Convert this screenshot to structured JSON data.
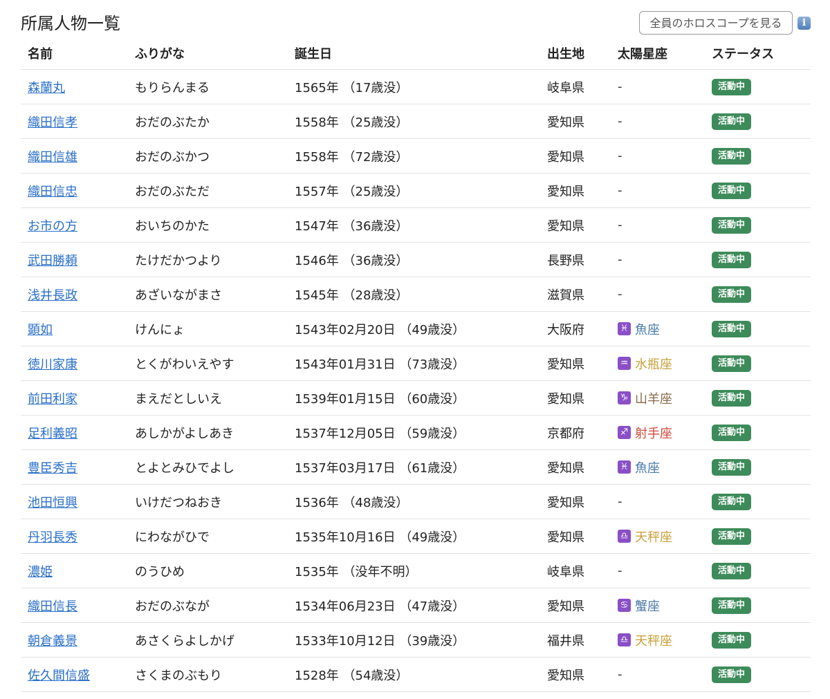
{
  "page": {
    "title": "所属人物一覧",
    "horoscope_button": "全員のホロスコープを見る",
    "info_icon": "i"
  },
  "table": {
    "headers": [
      "名前",
      "ふりがな",
      "誕生日",
      "出生地",
      "太陽星座",
      "ステータス"
    ],
    "rows": [
      {
        "name": "森蘭丸",
        "furigana": "もりらんまる",
        "birth": "1565年 （17歳没）",
        "place": "岐阜県",
        "zodiac": {
          "text": "-"
        },
        "status": "活動中"
      },
      {
        "name": "織田信孝",
        "furigana": "おだのぶたか",
        "birth": "1558年 （25歳没）",
        "place": "愛知県",
        "zodiac": {
          "text": "-"
        },
        "status": "活動中"
      },
      {
        "name": "織田信雄",
        "furigana": "おだのぶかつ",
        "birth": "1558年 （72歳没）",
        "place": "愛知県",
        "zodiac": {
          "text": "-"
        },
        "status": "活動中"
      },
      {
        "name": "織田信忠",
        "furigana": "おだのぶただ",
        "birth": "1557年 （25歳没）",
        "place": "愛知県",
        "zodiac": {
          "text": "-"
        },
        "status": "活動中"
      },
      {
        "name": "お市の方",
        "furigana": "おいちのかた",
        "birth": "1547年 （36歳没）",
        "place": "愛知県",
        "zodiac": {
          "text": "-"
        },
        "status": "活動中"
      },
      {
        "name": "武田勝頼",
        "furigana": "たけだかつより",
        "birth": "1546年 （36歳没）",
        "place": "長野県",
        "zodiac": {
          "text": "-"
        },
        "status": "活動中"
      },
      {
        "name": "浅井長政",
        "furigana": "あざいながまさ",
        "birth": "1545年 （28歳没）",
        "place": "滋賀県",
        "zodiac": {
          "text": "-"
        },
        "status": "活動中"
      },
      {
        "name": "顕如",
        "furigana": "けんにょ",
        "birth": "1543年02月20日 （49歳没）",
        "place": "大阪府",
        "zodiac": {
          "text": "魚座",
          "symbol": "♓",
          "icon": "pisces-icon",
          "color": "#4a7aa8"
        },
        "status": "活動中"
      },
      {
        "name": "徳川家康",
        "furigana": "とくがわいえやす",
        "birth": "1543年01月31日 （73歳没）",
        "place": "愛知県",
        "zodiac": {
          "text": "水瓶座",
          "symbol": "♒",
          "icon": "aquarius-icon",
          "color": "#c9a13b"
        },
        "status": "活動中"
      },
      {
        "name": "前田利家",
        "furigana": "まえだとしいえ",
        "birth": "1539年01月15日 （60歳没）",
        "place": "愛知県",
        "zodiac": {
          "text": "山羊座",
          "symbol": "♑",
          "icon": "capricorn-icon",
          "color": "#8a6a4a"
        },
        "status": "活動中"
      },
      {
        "name": "足利義昭",
        "furigana": "あしかがよしあき",
        "birth": "1537年12月05日 （59歳没）",
        "place": "京都府",
        "zodiac": {
          "text": "射手座",
          "symbol": "♐",
          "icon": "sagittarius-icon",
          "color": "#d04a3a"
        },
        "status": "活動中"
      },
      {
        "name": "豊臣秀吉",
        "furigana": "とよとみひでよし",
        "birth": "1537年03月17日 （61歳没）",
        "place": "愛知県",
        "zodiac": {
          "text": "魚座",
          "symbol": "♓",
          "icon": "pisces-icon",
          "color": "#4a7aa8"
        },
        "status": "活動中"
      },
      {
        "name": "池田恒興",
        "furigana": "いけだつねおき",
        "birth": "1536年 （48歳没）",
        "place": "愛知県",
        "zodiac": {
          "text": "-"
        },
        "status": "活動中"
      },
      {
        "name": "丹羽長秀",
        "furigana": "にわながひで",
        "birth": "1535年10月16日 （49歳没）",
        "place": "愛知県",
        "zodiac": {
          "text": "天秤座",
          "symbol": "♎",
          "icon": "libra-icon",
          "color": "#c9a13b"
        },
        "status": "活動中"
      },
      {
        "name": "濃姫",
        "furigana": "のうひめ",
        "birth": "1535年 （没年不明）",
        "place": "岐阜県",
        "zodiac": {
          "text": "-"
        },
        "status": "活動中"
      },
      {
        "name": "織田信長",
        "furigana": "おだのぶなが",
        "birth": "1534年06月23日 （47歳没）",
        "place": "愛知県",
        "zodiac": {
          "text": "蟹座",
          "symbol": "♋",
          "icon": "cancer-icon",
          "color": "#4a7aa8"
        },
        "status": "活動中"
      },
      {
        "name": "朝倉義景",
        "furigana": "あさくらよしかげ",
        "birth": "1533年10月12日 （39歳没）",
        "place": "福井県",
        "zodiac": {
          "text": "天秤座",
          "symbol": "♎",
          "icon": "libra-icon",
          "color": "#c9a13b"
        },
        "status": "活動中"
      },
      {
        "name": "佐久間信盛",
        "furigana": "さくまのぶもり",
        "birth": "1528年 （54歳没）",
        "place": "愛知県",
        "zodiac": {
          "text": "-"
        },
        "status": "活動中"
      }
    ]
  },
  "colors": {
    "link": "#2a6fc9",
    "status_badge": "#3d8b5a",
    "zodiac_icon_bg": "#8a4fc7"
  }
}
